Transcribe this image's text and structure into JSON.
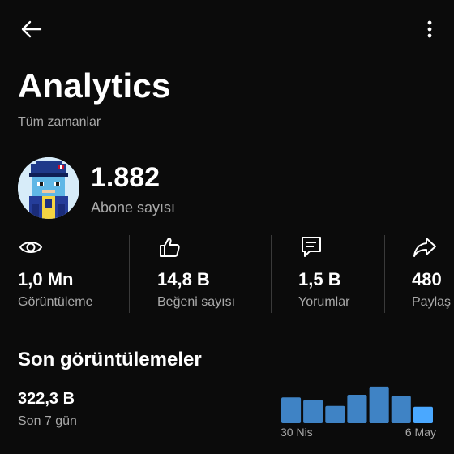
{
  "header": {
    "back_icon": "arrow-left-icon",
    "menu_icon": "more-vertical-icon"
  },
  "page": {
    "title": "Analytics",
    "subtitle": "Tüm zamanlar"
  },
  "channel": {
    "subscriber_count": "1.882",
    "subscriber_label": "Abone sayısı",
    "avatar_icon": "pixel-character-avatar"
  },
  "stats": [
    {
      "icon": "eye-icon",
      "value": "1,0 Mn",
      "label": "Görüntüleme"
    },
    {
      "icon": "thumbs-up-icon",
      "value": "14,8 B",
      "label": "Beğeni sayısı"
    },
    {
      "icon": "comment-icon",
      "value": "1,5 B",
      "label": "Yorumlar"
    },
    {
      "icon": "share-icon",
      "value": "480",
      "label": "Paylaş"
    }
  ],
  "recent": {
    "title": "Son görüntülemeler",
    "value": "322,3 B",
    "period_label": "Son 7 gün",
    "x_start": "30 Nis",
    "x_end": "6 May"
  },
  "chart_data": {
    "type": "bar",
    "values": [
      0.69,
      0.62,
      0.46,
      0.76,
      0.98,
      0.73,
      0.44
    ],
    "colors": [
      "#3f83c5",
      "#3f83c5",
      "#3f83c5",
      "#3f83c5",
      "#3f83c5",
      "#3f83c5",
      "#4aa8ff"
    ]
  }
}
